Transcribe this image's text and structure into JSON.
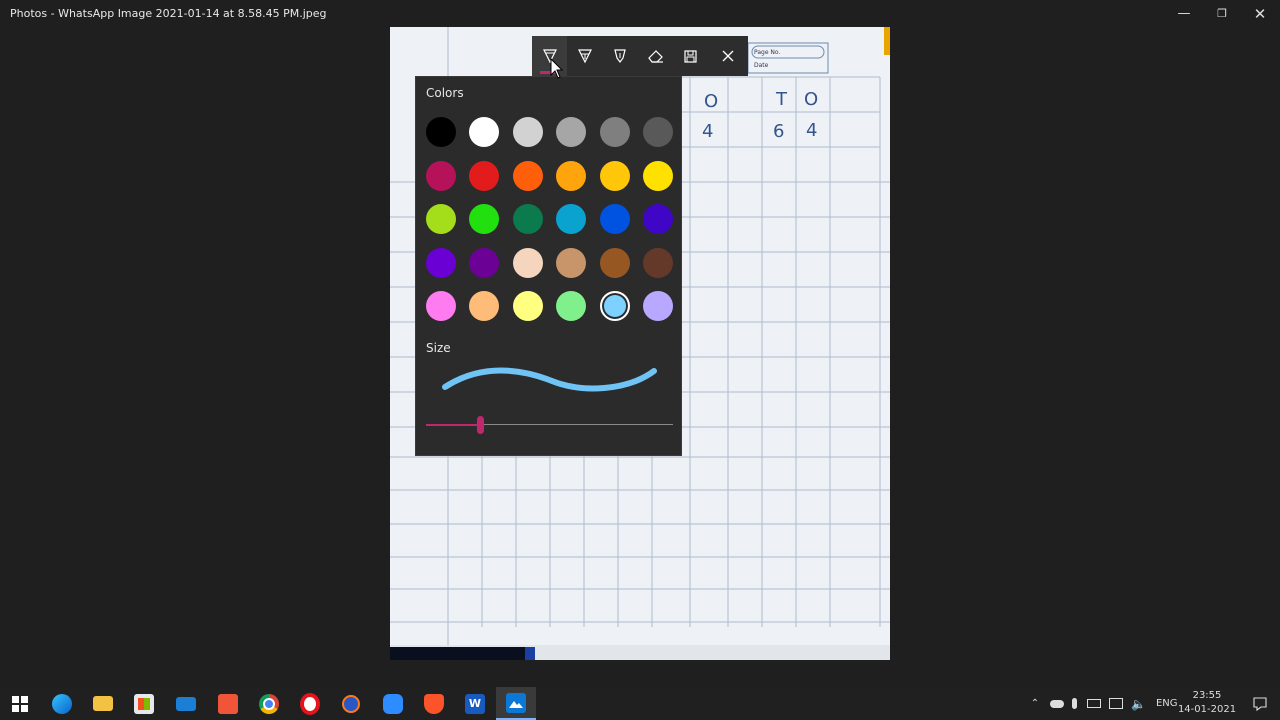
{
  "window": {
    "title": "Photos - WhatsApp Image 2021-01-14 at 8.58.45 PM.jpeg",
    "controls": [
      "minimize-icon",
      "restore-icon",
      "close-icon"
    ]
  },
  "photo": {
    "labels": {
      "page_no": "Page No.",
      "date": "Date"
    },
    "handwriting": [
      {
        "text": "O"
      },
      {
        "text": "T"
      },
      {
        "text": "O"
      },
      {
        "text": "4"
      },
      {
        "text": "6"
      },
      {
        "text": "4"
      }
    ]
  },
  "toolbar": {
    "tools": [
      {
        "name": "ballpoint-pen-icon",
        "active": true
      },
      {
        "name": "pencil-icon",
        "active": false
      },
      {
        "name": "calligraphy-pen-icon",
        "active": false
      },
      {
        "name": "eraser-icon",
        "active": false
      },
      {
        "name": "save-copy-icon",
        "active": false
      },
      {
        "name": "close-icon",
        "active": false
      }
    ]
  },
  "flyout": {
    "colors_label": "Colors",
    "size_label": "Size",
    "stroke_color": "#6fc3f5",
    "slider_color": "#c0286d",
    "slider_value_fraction": 0.22,
    "colors": [
      "#000000",
      "#ffffff",
      "#d2d2d2",
      "#a6a6a6",
      "#7f7f7f",
      "#595959",
      "#b5125a",
      "#e21c1c",
      "#ff5f0a",
      "#ffa40d",
      "#ffc60a",
      "#ffe100",
      "#a4dd1a",
      "#22e010",
      "#0b7a4c",
      "#0aa3cf",
      "#0052e1",
      "#4006c6",
      "#6a00d3",
      "#6b0295",
      "#f5d5be",
      "#c8956a",
      "#975723",
      "#64392a",
      "#ff7bf0",
      "#ffbc78",
      "#ffff80",
      "#80f08c",
      "#7dd1ff",
      "#b8a8ff"
    ],
    "selected_index": 28
  },
  "taskbar": {
    "apps": [
      {
        "name": "start-icon"
      },
      {
        "name": "edge-icon"
      },
      {
        "name": "file-explorer-icon"
      },
      {
        "name": "store-icon"
      },
      {
        "name": "mail-icon"
      },
      {
        "name": "app-icon"
      },
      {
        "name": "chrome-icon"
      },
      {
        "name": "opera-icon"
      },
      {
        "name": "app-icon-2"
      },
      {
        "name": "zoom-icon"
      },
      {
        "name": "brave-icon"
      },
      {
        "name": "word-icon"
      },
      {
        "name": "photos-icon"
      }
    ],
    "tray": {
      "lang": "ENG",
      "time": "23:55",
      "date": "14-01-2021"
    }
  }
}
